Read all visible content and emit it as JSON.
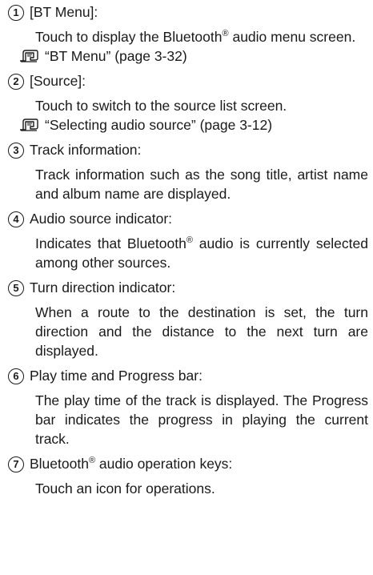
{
  "items": [
    {
      "number": "1",
      "label": "[BT Menu]:",
      "desc_a": "Touch to display the Bluetooth",
      "desc_sup": "®",
      "desc_b": " audio menu screen.",
      "ref": "“BT Menu” (page 3-32)"
    },
    {
      "number": "2",
      "label": "[Source]:",
      "desc": "Touch to switch to the source list screen.",
      "ref": "“Selecting audio source” (page 3-12)"
    },
    {
      "number": "3",
      "label": "Track information:",
      "desc": "Track information such as the song title, artist name and album name are displayed."
    },
    {
      "number": "4",
      "label": "Audio source indicator:",
      "desc_a": "Indicates that Bluetooth",
      "desc_sup": "®",
      "desc_b": " audio is currently selected among other sources."
    },
    {
      "number": "5",
      "label": "Turn direction indicator:",
      "desc": "When a route to the destination is set, the turn direction and the distance to the next turn are displayed."
    },
    {
      "number": "6",
      "label": "Play time and Progress bar:",
      "desc": "The play time of the track is displayed. The Progress bar indicates the progress in playing the current track."
    },
    {
      "number": "7",
      "label_a": "Bluetooth",
      "label_sup": "®",
      "label_b": " audio operation keys:",
      "desc": "Touch an icon for operations."
    }
  ],
  "icons": {
    "reference": "reference-hand-icon"
  }
}
